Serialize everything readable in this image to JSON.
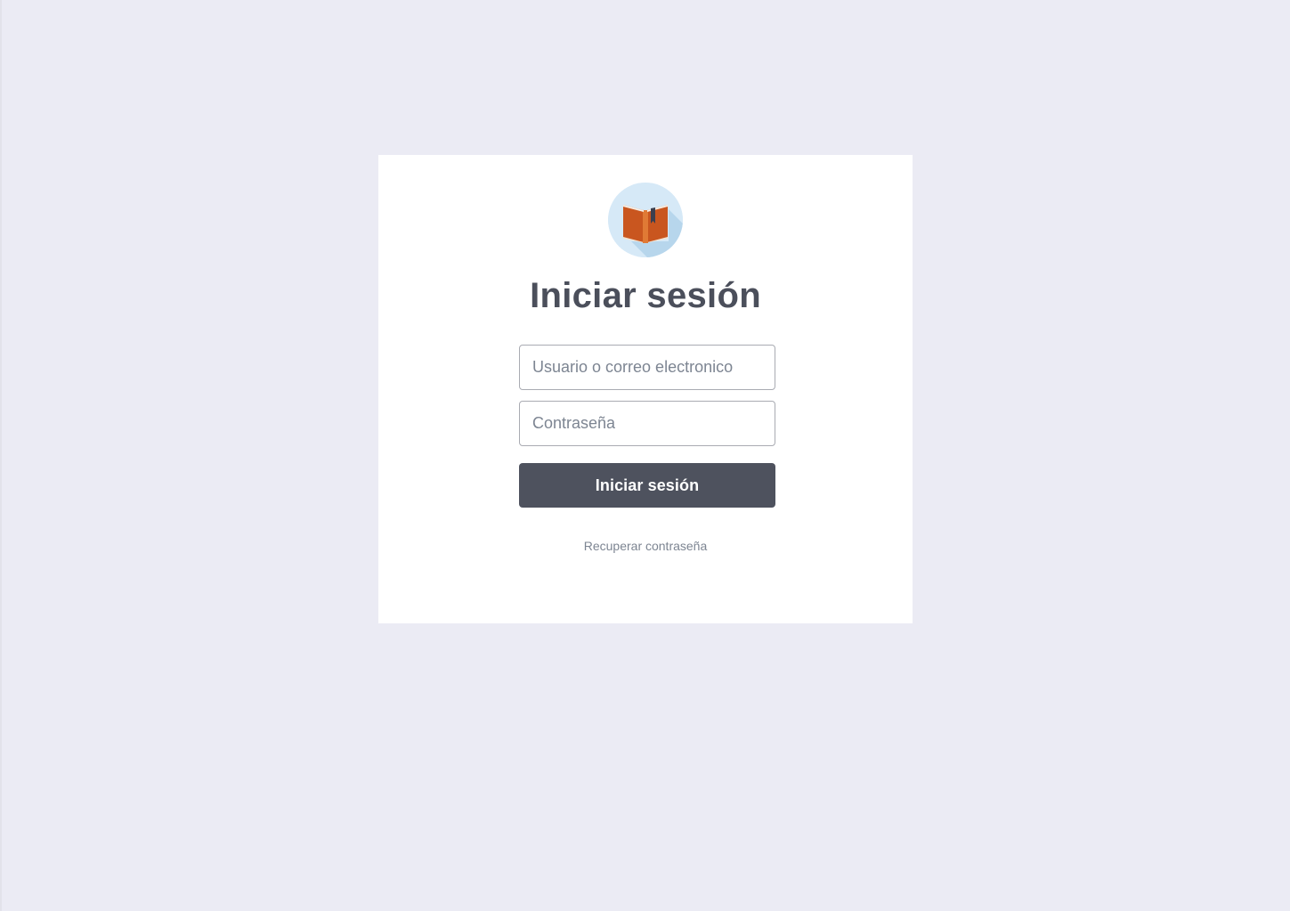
{
  "login": {
    "logo_icon": "open-book-icon",
    "title": "Iniciar sesión",
    "username": {
      "placeholder": "Usuario o correo electronico",
      "value": ""
    },
    "password": {
      "placeholder": "Contraseña",
      "value": ""
    },
    "submit_label": "Iniciar sesión",
    "recover_label": "Recuperar contraseña"
  },
  "colors": {
    "page_background": "#ebebf4",
    "card_background": "#ffffff",
    "text_dark": "#4b4f5b",
    "button_background": "#4e525e",
    "muted_text": "#7d8592",
    "logo_circle": "#d6e9f7",
    "book_cover": "#c9561f"
  }
}
